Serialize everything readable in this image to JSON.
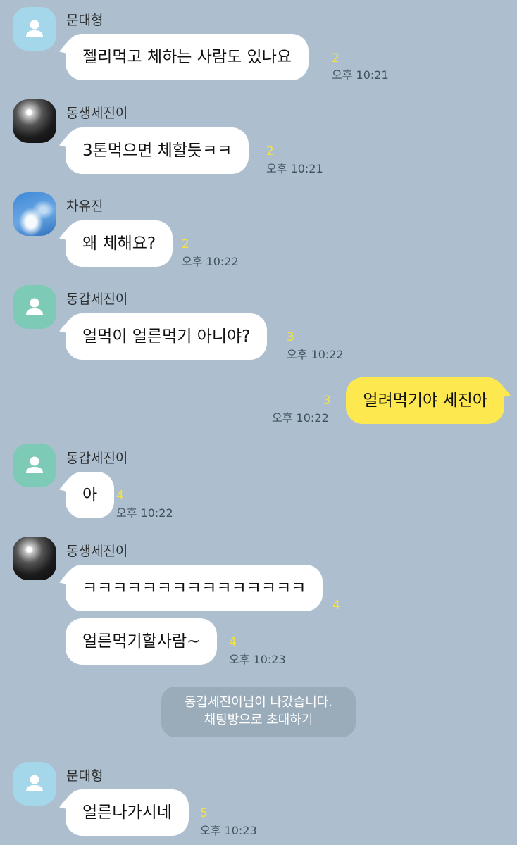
{
  "messages": [
    {
      "sender": "문대형",
      "text": "젤리먹고 체하는 사람도 있나요",
      "unread": "2",
      "time": "오후 10:21"
    },
    {
      "sender": "동생세진이",
      "text": "3톤먹으면 체할듯ㅋㅋ",
      "unread": "2",
      "time": "오후 10:21"
    },
    {
      "sender": "차유진",
      "text": "왜 체해요?",
      "unread": "2",
      "time": "오후 10:22"
    },
    {
      "sender": "동갑세진이",
      "text": "얼먹이 얼른먹기 아니야?",
      "unread": "3",
      "time": "오후 10:22"
    },
    {
      "sender": "",
      "text": "얼려먹기야 세진아",
      "unread": "3",
      "time": "오후 10:22"
    },
    {
      "sender": "동갑세진이",
      "text": "아",
      "unread": "4",
      "time": "오후 10:22"
    },
    {
      "sender": "동생세진이",
      "text": "ㅋㅋㅋㅋㅋㅋㅋㅋㅋㅋㅋㅋㅋㅋㅋ",
      "unread": "4",
      "time": ""
    },
    {
      "sender": "",
      "text": "얼른먹기할사람~",
      "unread": "4",
      "time": "오후 10:23"
    },
    {
      "sender": "문대형",
      "text": "얼른나가시네",
      "unread": "5",
      "time": "오후 10:23"
    }
  ],
  "system_notice": {
    "text": "동갑세진이님이 나갔습니다.",
    "link": "채팅방으로 초대하기"
  },
  "colors": {
    "background": "#adbfcf",
    "my_bubble": "#fde84f",
    "other_bubble": "#ffffff",
    "unread": "#f6e33a",
    "default_avatar_blue": "#a5d7ea",
    "default_avatar_green": "#7dcab6"
  },
  "icons": {
    "default_avatar": "person-icon"
  }
}
